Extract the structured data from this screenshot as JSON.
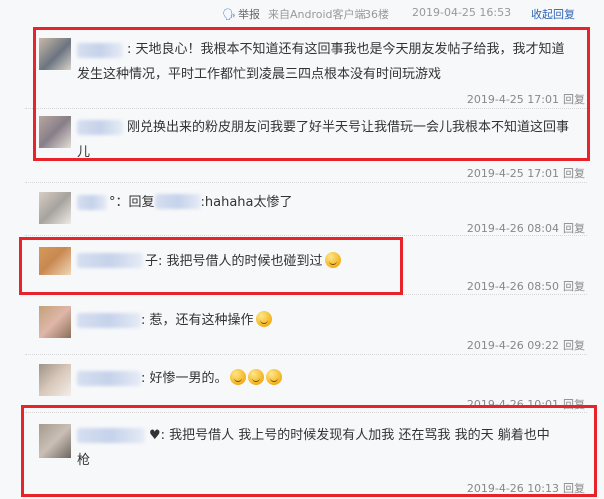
{
  "topbar": {
    "report_label": "举报",
    "source": "来自Android客户端",
    "floor": "36楼",
    "time": "2019-04-25 16:53",
    "collapse_label": "收起回复"
  },
  "replies": [
    {
      "prefix": ": ",
      "text": "天地良心！我根本不知道还有这回事我也是今天朋友发帖子给我，我才知道发生这种情况，平时工作都忙到凌晨三四点根本没有时间玩游戏",
      "time": "2019-4-25 17:01",
      "reply_label": "回复"
    },
    {
      "prefix": "",
      "text": "刚兑换出来的粉皮朋友问我要了好半天号让我借玩一会儿我根本不知道这回事儿",
      "time": "2019-4-25 17:01",
      "reply_label": "回复"
    },
    {
      "prefix": "°：回复",
      "text": ":hahaha太惨了",
      "time": "2019-4-26 08:04",
      "reply_label": "回复"
    },
    {
      "prefix": "子: ",
      "text": "我把号借人的时候也碰到过",
      "time": "2019-4-26 08:50",
      "reply_label": "回复"
    },
    {
      "prefix": ": ",
      "text": "惹，还有这种操作",
      "time": "2019-4-26 09:22",
      "reply_label": "回复"
    },
    {
      "prefix": ": ",
      "text": "好惨一男的。",
      "time": "2019-4-26 10:01",
      "reply_label": "回复"
    },
    {
      "prefix": "♥: ",
      "text": "我把号借人 我上号的时候发现有人加我 还在骂我 我的天 躺着也中枪",
      "time": "2019-4-26 10:13",
      "reply_label": "回复"
    }
  ],
  "colors": {
    "highlight_box": "#e8232a",
    "link": "#2d64b3"
  }
}
